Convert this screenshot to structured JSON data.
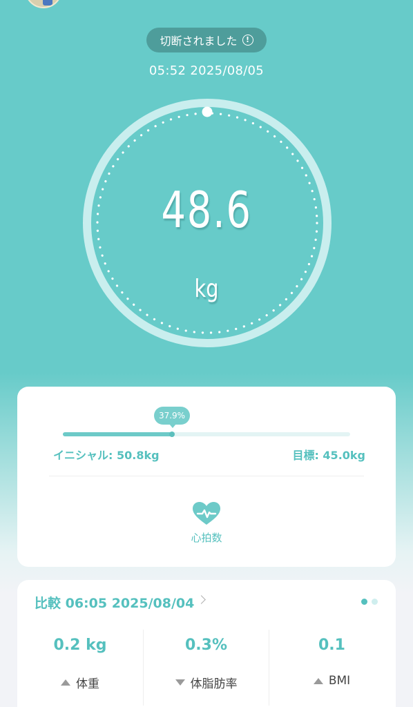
{
  "header": {
    "status_text": "切断されました",
    "datetime": "05:52 2025/08/05"
  },
  "gauge": {
    "value": "48.6",
    "unit": "kg"
  },
  "goal": {
    "progress_label": "37.9%",
    "progress_fraction": 0.379,
    "initial_label": "イニシャル: 50.8kg",
    "target_label": "目標: 45.0kg",
    "heart_rate_label": "心拍数"
  },
  "comparison": {
    "title": "比較 06:05 2025/08/04",
    "metrics": [
      {
        "value": "0.2 kg",
        "label": "体重",
        "direction": "up"
      },
      {
        "value": "0.3%",
        "label": "体脂肪率",
        "direction": "down"
      },
      {
        "value": "0.1",
        "label": "BMI",
        "direction": "up"
      }
    ]
  },
  "colors": {
    "primary_background": "#67cbc9",
    "accent": "#55c0be",
    "status_pill": "#4e9d9b"
  },
  "icons": [
    "info-icon",
    "heart-rate-icon",
    "chevron-right-icon",
    "triangle-up-icon",
    "triangle-down-icon"
  ]
}
